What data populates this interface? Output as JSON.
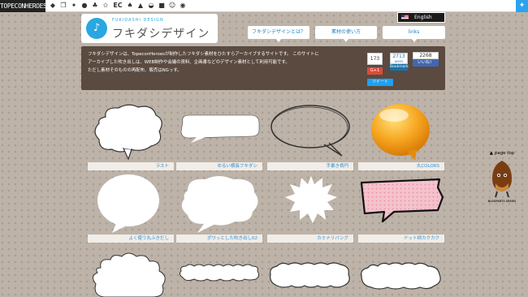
{
  "topbar": {
    "brand": "TOPECONHEROES",
    "icons": [
      {
        "icon": "tag-icon",
        "label": ""
      },
      {
        "icon": "copy-icon",
        "label": ""
      },
      {
        "icon": "figure-icon",
        "label": ""
      },
      {
        "icon": "bubble-icon",
        "label": ""
      },
      {
        "icon": "leaf-icon",
        "label": ""
      },
      {
        "icon": "star-icon",
        "label": ""
      },
      {
        "icon": "ec-text",
        "label": "EC"
      },
      {
        "icon": "tree-icon",
        "label": ""
      },
      {
        "icon": "live-icon",
        "label": ""
      },
      {
        "icon": "rice-icon",
        "label": ""
      },
      {
        "icon": "p-icon",
        "label": ""
      },
      {
        "icon": "face-icon",
        "label": ""
      },
      {
        "icon": "on-icon",
        "label": ""
      }
    ],
    "twitter_icon": "twitter-icon"
  },
  "header": {
    "logo_icon": "speech-figure-icon",
    "logo_sub": "FUKIDASHI DESIGN",
    "logo_text": "フキダシデザイン",
    "language": "English",
    "nav": [
      {
        "label": "フキダシデザインとは？"
      },
      {
        "label": "素材の使い方"
      },
      {
        "label": "links"
      }
    ]
  },
  "intro": {
    "lines": [
      "フキダシデザインは、TopeconHeroesが制作したフキダシ素材をひたすらアーカイブするサイトです。 このサイトに",
      "アーカイブした吹き出しは、WEB制作や会議の資料、企画書などのデザイン素材として利用可能です。",
      "ただし素材そのものの再配布、販売はNGっす。"
    ],
    "share": {
      "gplus_count": "173",
      "gplus_label": "G+1",
      "hatena_count": "2713",
      "hatena_sub": "users",
      "hatena_label": "Bookmark",
      "fb_count": "2268",
      "fb_label": "いいね！",
      "tweet_label": "ツイート"
    }
  },
  "cards": [
    {
      "label": "ラスト",
      "kind": "cloud-plain"
    },
    {
      "label": "ゆるい横長フキダシ",
      "kind": "wide-plain"
    },
    {
      "label": "手書き楕円",
      "kind": "hand-ellipse"
    },
    {
      "label": "丸COLORS",
      "kind": "orange-ball"
    },
    {
      "label": "よく使う丸ふきだし",
      "kind": "round"
    },
    {
      "label": "ポワッとした吹き出し02",
      "kind": "cloud-soft"
    },
    {
      "label": "カミナリバング",
      "kind": "burst"
    },
    {
      "label": "ドット柄カクカク",
      "kind": "dot-box"
    },
    {
      "label": "",
      "kind": "fluffy"
    },
    {
      "label": "",
      "kind": "fluffy-wide"
    },
    {
      "label": "",
      "kind": "fluffy-wide2"
    },
    {
      "label": "",
      "kind": "fluffy-wide3"
    }
  ],
  "pagetop": {
    "label": "page top",
    "character_icon": "chestnut-character-icon",
    "footer": "BLOGPARTS SERIES"
  },
  "colors": {
    "accent": "#29a7e1",
    "link": "#2a8fd6",
    "panel": "#5a4a40",
    "orange": "#f7a823",
    "dot_pink": "#f4c2cc"
  }
}
